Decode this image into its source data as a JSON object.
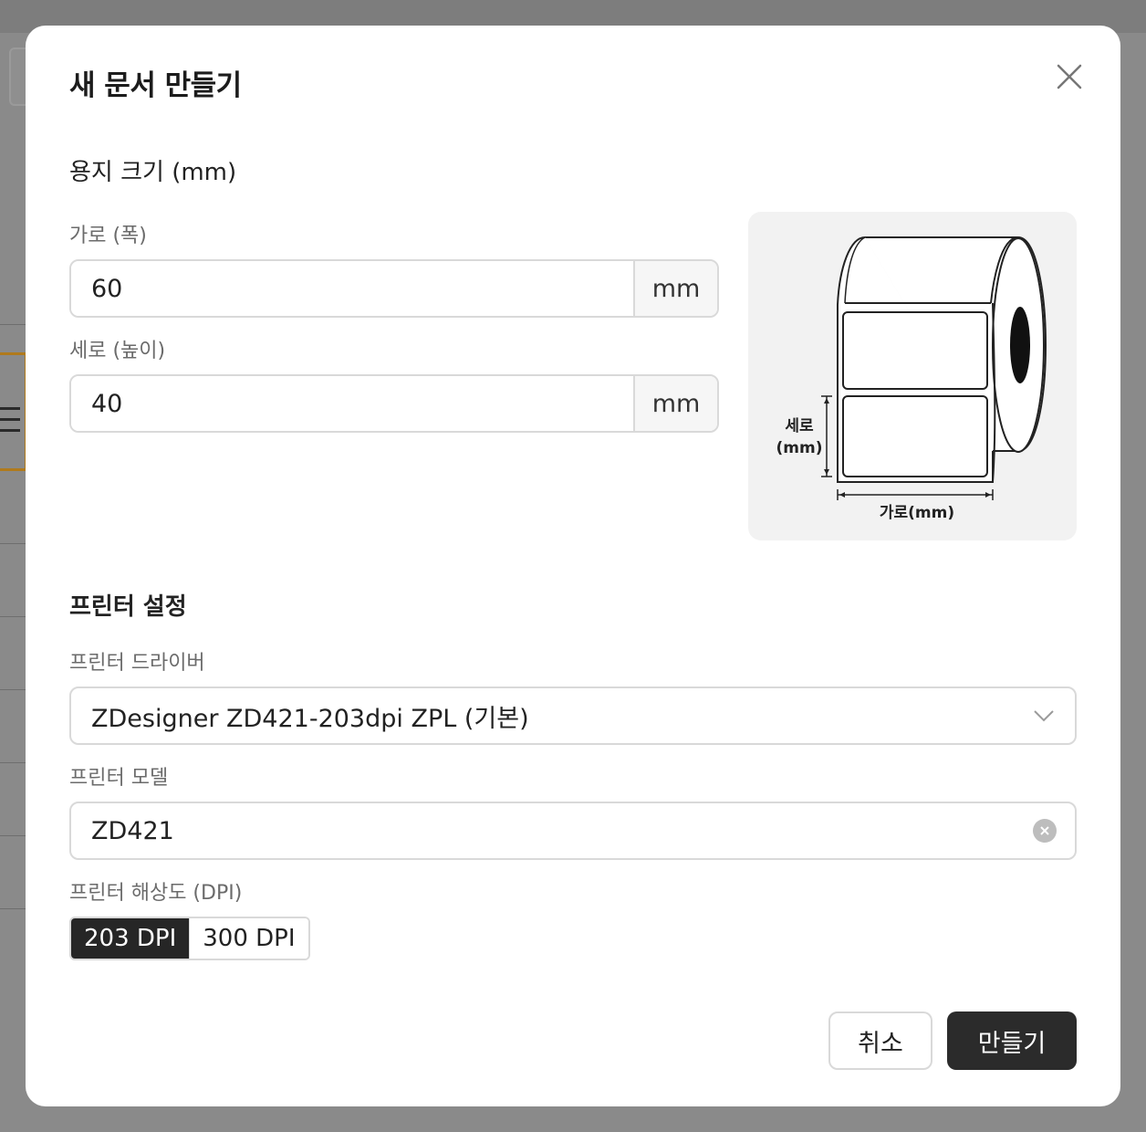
{
  "dialog": {
    "title": "새 문서 만들기",
    "close_icon": "close-icon"
  },
  "paper": {
    "section_title": "용지 크기 (mm)",
    "width_label": "가로 (폭)",
    "width_value": "60",
    "height_label": "세로 (높이)",
    "height_value": "40",
    "unit": "mm"
  },
  "preview": {
    "height_label_line1": "세로",
    "height_label_line2": "(mm)",
    "width_label": "가로(mm)"
  },
  "printer": {
    "section_title": "프린터 설정",
    "driver_label": "프린터 드라이버",
    "driver_value": "ZDesigner ZD421-203dpi ZPL (기본)",
    "model_label": "프린터 모델",
    "model_value": "ZD421",
    "dpi_label": "프린터 해상도 (DPI)",
    "dpi_options": [
      "203 DPI",
      "300 DPI"
    ],
    "dpi_selected": "203 DPI"
  },
  "actions": {
    "cancel_label": "취소",
    "create_label": "만들기"
  },
  "colors": {
    "primary_dark": "#2b2b2b",
    "border": "#d9d9d9",
    "overlay": "#8a8a8a"
  }
}
